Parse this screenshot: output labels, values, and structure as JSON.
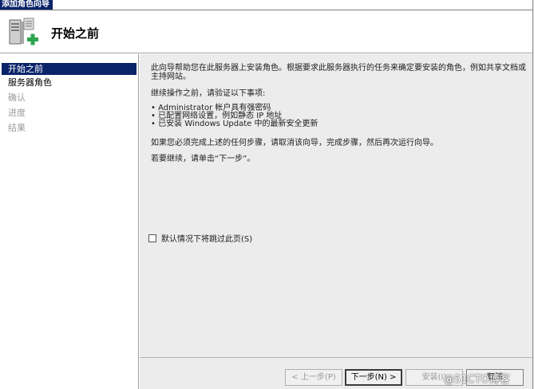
{
  "window": {
    "title": "添加角色向导"
  },
  "header": {
    "title": "开始之前",
    "icon": "server-roles-add-icon"
  },
  "sidebar": {
    "items": [
      {
        "label": "开始之前",
        "state": "active"
      },
      {
        "label": "服务器角色",
        "state": "enabled"
      },
      {
        "label": "确认",
        "state": "disabled"
      },
      {
        "label": "进度",
        "state": "disabled"
      },
      {
        "label": "结果",
        "state": "disabled"
      }
    ]
  },
  "content": {
    "intro": "此向导帮助您在此服务器上安装角色。根据要求此服务器执行的任务来确定要安装的角色，例如共享文档或主持网站。",
    "before_continue": "继续操作之前，请验证以下事项:",
    "checks": [
      "Administrator 帐户具有强密码",
      "已配置网络设置，例如静态 IP 地址",
      "已安装 Windows Update 中的最新安全更新"
    ],
    "cancel_note": "如果您必须完成上述的任何步骤，请取消该向导，完成步骤，然后再次运行向导。",
    "continue_note": "若要继续，请单击“下一步”。",
    "skip_checkbox": {
      "label": "默认情况下将跳过此页(S)",
      "checked": false
    }
  },
  "footer": {
    "prev_label": "< 上一步(P)",
    "next_label": "下一步(N) >",
    "install_label": "安装(I)",
    "cancel_label": "取消"
  },
  "watermark": "@51CTO博客",
  "colors": {
    "selection": "#0a246a",
    "panel": "#ececec"
  }
}
